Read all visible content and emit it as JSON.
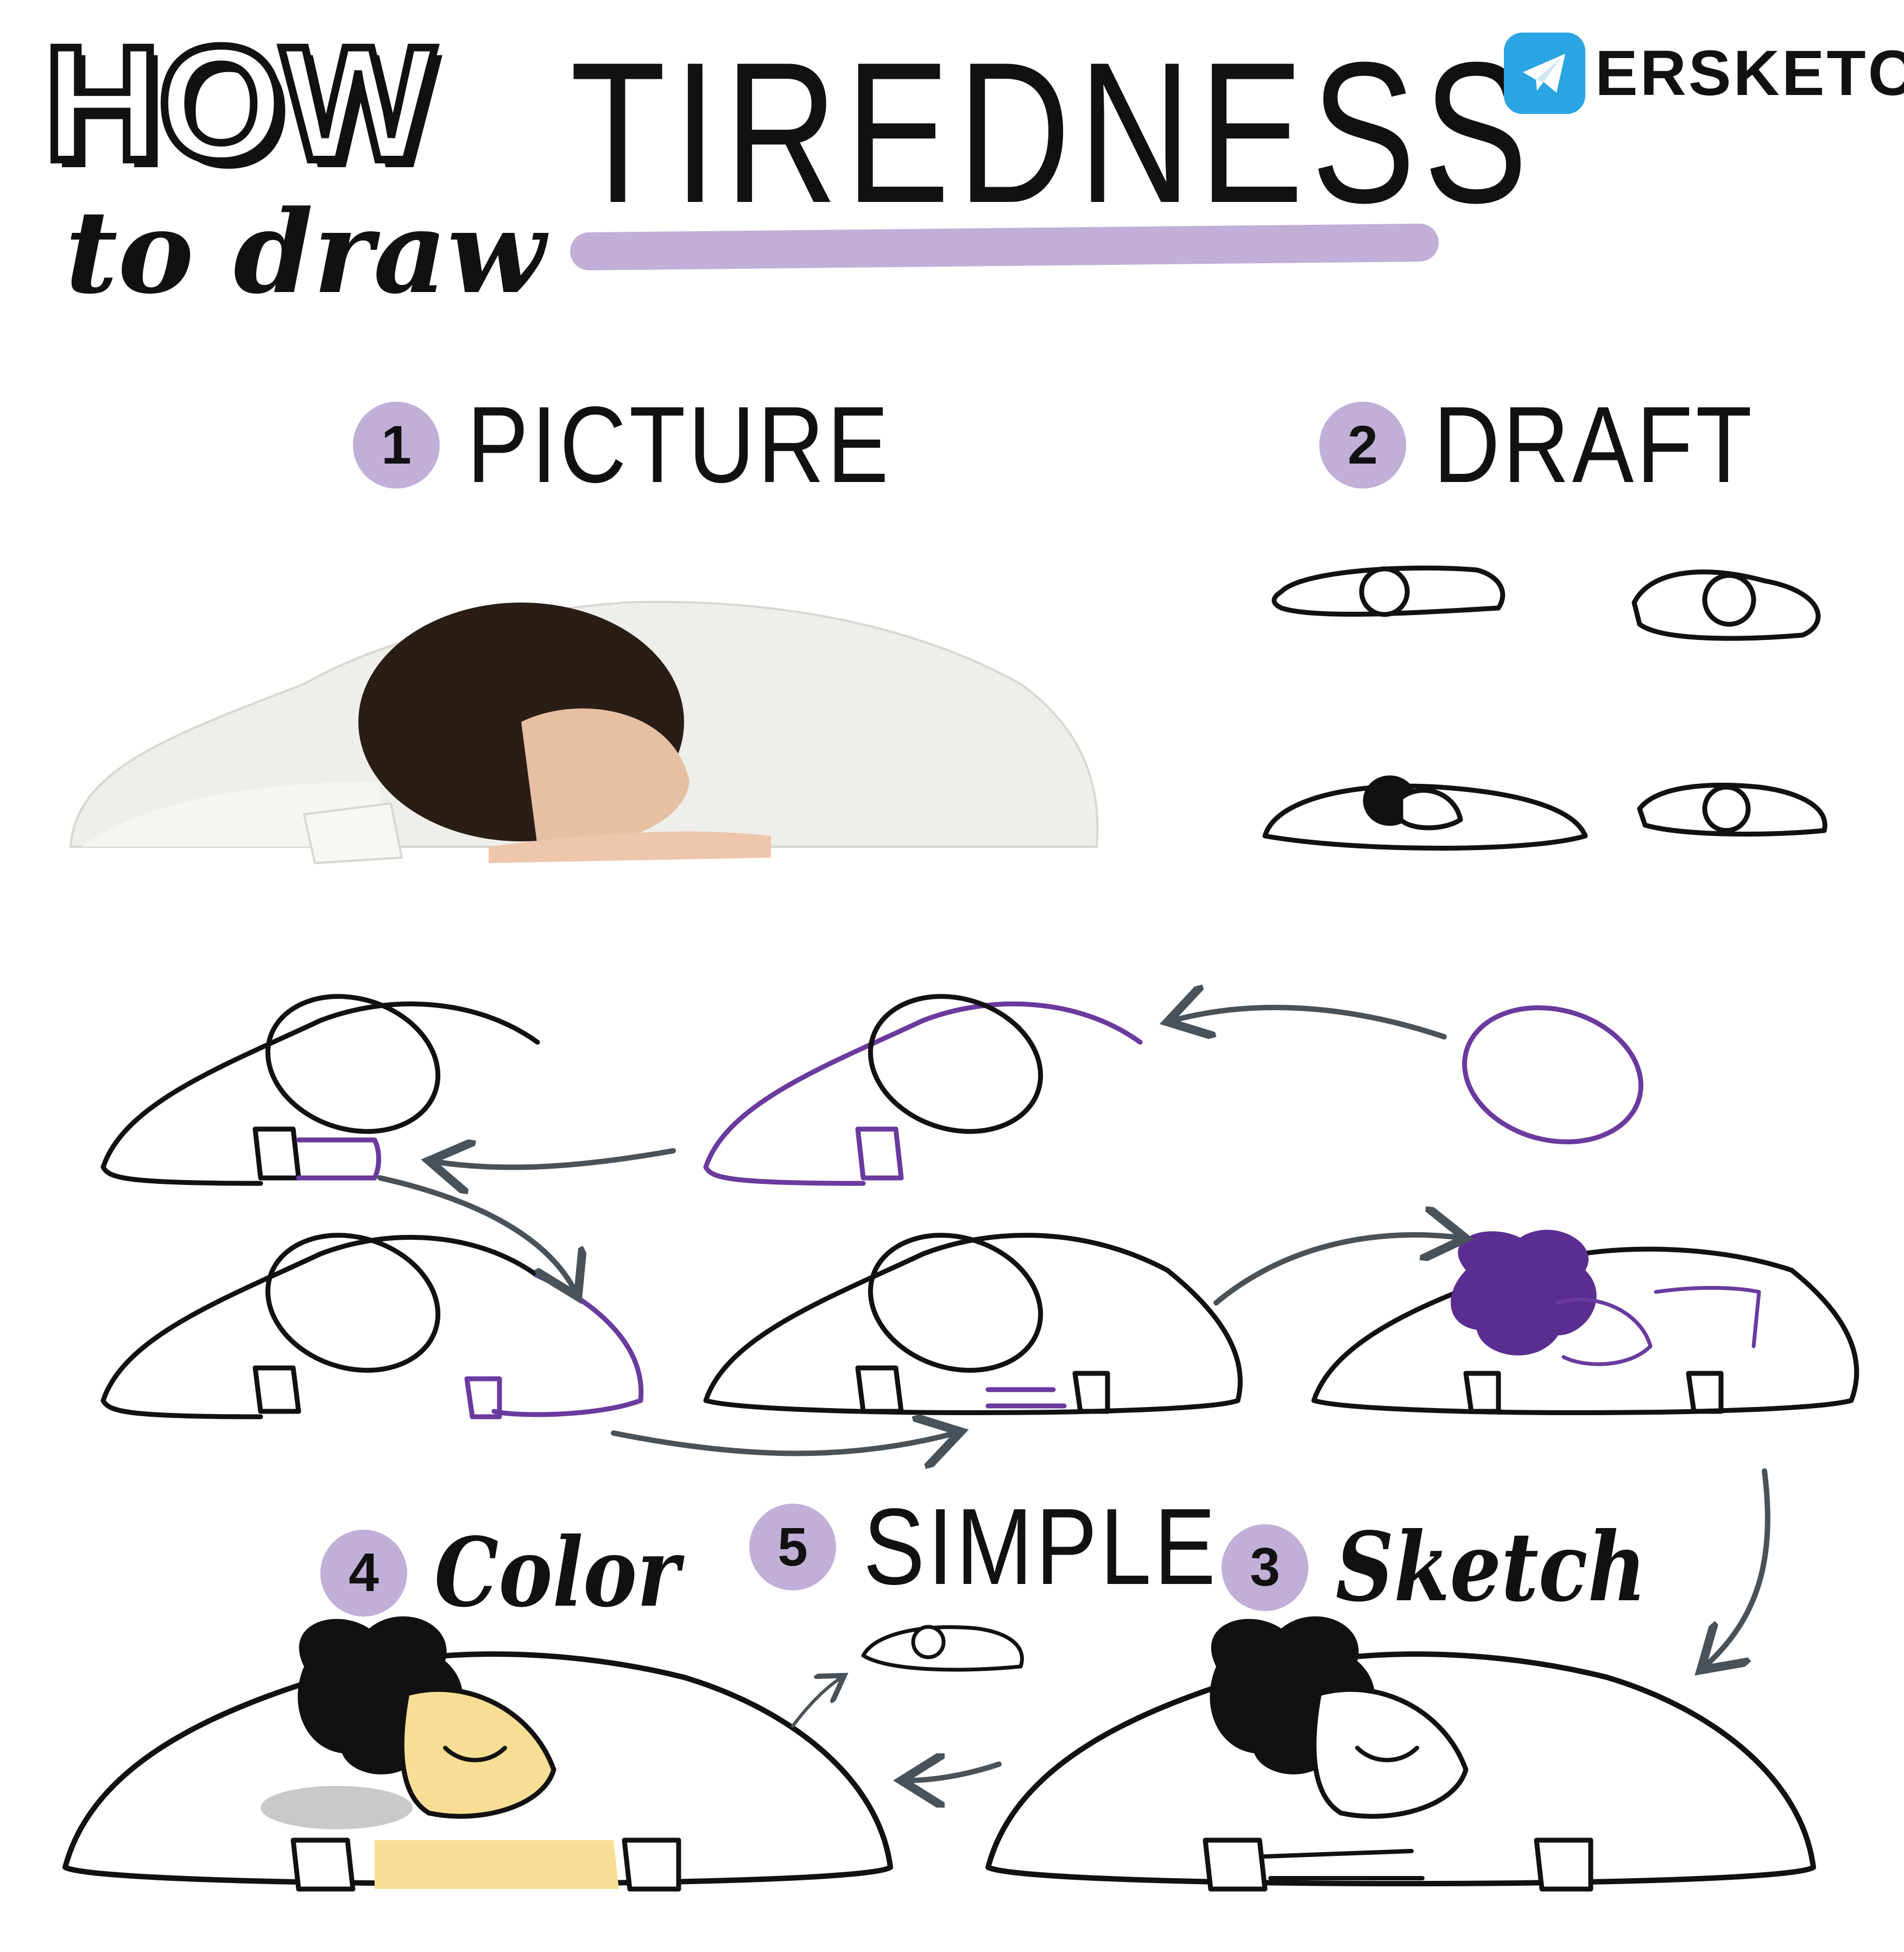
{
  "header": {
    "how": "HOW",
    "to_draw": "to draw",
    "title": "TIREDNESS",
    "brand": "ERSKETCH"
  },
  "steps": [
    {
      "number": "1",
      "label": "PICTURE"
    },
    {
      "number": "2",
      "label": "DRAFT"
    },
    {
      "number": "3",
      "label": "Sketch"
    },
    {
      "number": "4",
      "label": "Color"
    },
    {
      "number": "5",
      "label": "SIMPLE"
    }
  ],
  "colors": {
    "accent_lavender": "#c1afd8",
    "purple_line": "#6a3a9e",
    "purple_hair": "#5b2d91",
    "arrow_gray": "#4a5259",
    "skin_yellow": "#f8de94",
    "shadow_gray": "#c9c9c9",
    "telegram_blue": "#2aa4e3"
  },
  "icons": [
    "telegram-icon",
    "arrow-icon"
  ]
}
